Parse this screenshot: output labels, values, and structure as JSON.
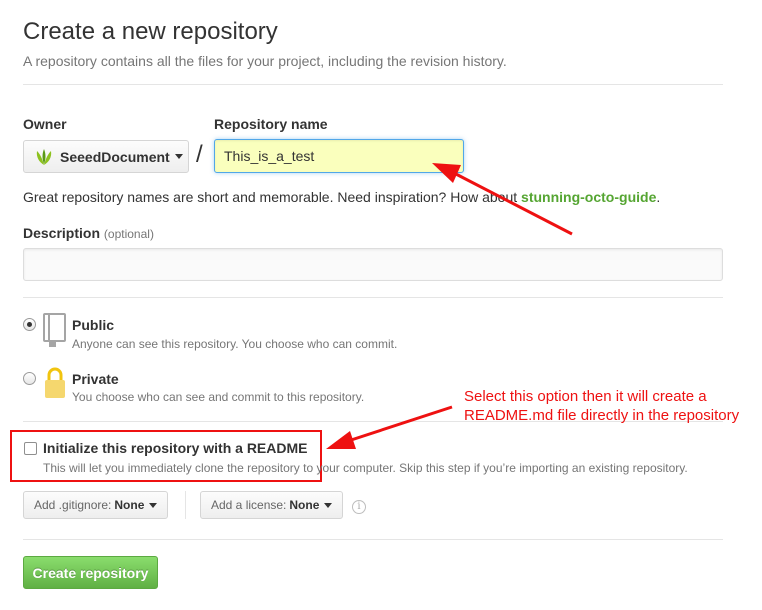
{
  "page": {
    "title": "Create a new repository",
    "subtitle": "A repository contains all the files for your project, including the revision history."
  },
  "owner": {
    "label": "Owner",
    "value": "SeeedDocument"
  },
  "separator": "/",
  "repo_name": {
    "label": "Repository name",
    "value": "This_is_a_test"
  },
  "hint": {
    "text": "Great repository names are short and memorable. Need inspiration? How about ",
    "suggestion": "stunning-octo-guide",
    "end": "."
  },
  "description": {
    "label": "Description",
    "optional": "(optional)",
    "value": ""
  },
  "visibility": {
    "public": {
      "title": "Public",
      "note": "Anyone can see this repository. You choose who can commit.",
      "selected": true
    },
    "private": {
      "title": "Private",
      "note": "You choose who can see and commit to this repository.",
      "selected": false
    }
  },
  "readme": {
    "label": "Initialize this repository with a README",
    "note": "This will let you immediately clone the repository to your computer. Skip this step if you’re importing an existing repository.",
    "checked": false
  },
  "gitignore": {
    "label": "Add .gitignore:",
    "value": "None"
  },
  "license": {
    "label": "Add a license:",
    "value": "None"
  },
  "info_icon": "info-icon",
  "create_button": "Create repository",
  "annotation": {
    "line1": "Select this option then it will create a",
    "line2": "README.md file directly in the repository"
  },
  "colors": {
    "accent_blue": "#51a7e8",
    "autofill_yellow": "#faffbd",
    "suggestion_green": "#55a532",
    "create_green": "#60b044",
    "annotation_red": "#ee1111"
  }
}
